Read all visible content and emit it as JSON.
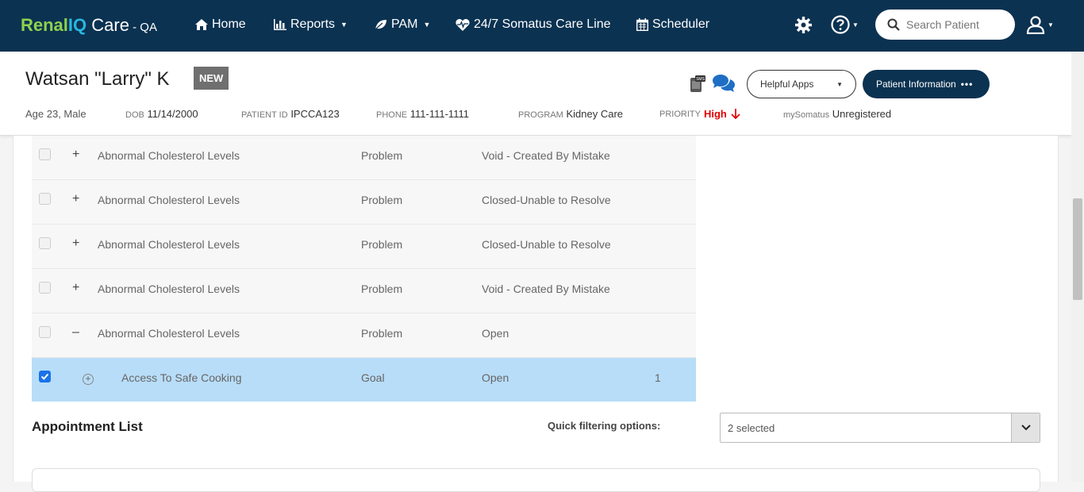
{
  "nav": {
    "logo": {
      "part1": "Renal",
      "part2": "IQ",
      "part3": " Care",
      "suffix": " - QA"
    },
    "items": [
      {
        "label": "Home",
        "icon": "home-icon"
      },
      {
        "label": "Reports",
        "icon": "bar-chart-icon"
      },
      {
        "label": "PAM",
        "icon": "leaf-icon"
      },
      {
        "label": "24/7 Somatus Care Line",
        "icon": "heartbeat-icon"
      },
      {
        "label": "Scheduler",
        "icon": "calendar-icon"
      }
    ],
    "search_placeholder": "Search Patient"
  },
  "patient": {
    "name": "Watsan \"Larry\" K",
    "badge": "NEW",
    "age_sex": "Age 23, Male",
    "dob_label": "DOB",
    "dob": "11/14/2000",
    "pid_label": "PATIENT ID",
    "pid": "IPCCA123",
    "phone_label": "PHONE",
    "phone": "111-111-1111",
    "program_label": "PROGRAM",
    "program": "Kidney Care",
    "priority_label": "PRIORITY",
    "priority": "High",
    "mysomatus_label": "mySomatus",
    "mysomatus": "Unregistered",
    "helpful_apps": "Helpful Apps",
    "patient_info": "Patient Information",
    "sms_label": "SMS"
  },
  "grid": {
    "rows": [
      {
        "expander": "+",
        "name": "Abnormal Cholesterol Levels",
        "type": "Problem",
        "status": "Void - Created By Mistake",
        "count": "",
        "checked": false
      },
      {
        "expander": "+",
        "name": "Abnormal Cholesterol Levels",
        "type": "Problem",
        "status": "Closed-Unable to Resolve",
        "count": "",
        "checked": false
      },
      {
        "expander": "+",
        "name": "Abnormal Cholesterol Levels",
        "type": "Problem",
        "status": "Closed-Unable to Resolve",
        "count": "",
        "checked": false
      },
      {
        "expander": "+",
        "name": "Abnormal Cholesterol Levels",
        "type": "Problem",
        "status": "Void - Created By Mistake",
        "count": "",
        "checked": false
      },
      {
        "expander": "–",
        "name": "Abnormal Cholesterol Levels",
        "type": "Problem",
        "status": "Open",
        "count": "",
        "checked": false
      },
      {
        "expander": "+",
        "name": "Access To Safe Cooking",
        "type": "Goal",
        "status": "Open",
        "count": "1",
        "checked": true
      }
    ]
  },
  "appointments": {
    "title": "Appointment List",
    "filter_label": "Quick filtering options:",
    "filter_value": "2 selected"
  },
  "colors": {
    "nav_bg": "#0b3251",
    "selected_row": "#b8ddf8",
    "priority_high": "#e00000",
    "checkbox_checked": "#1a73e8"
  }
}
